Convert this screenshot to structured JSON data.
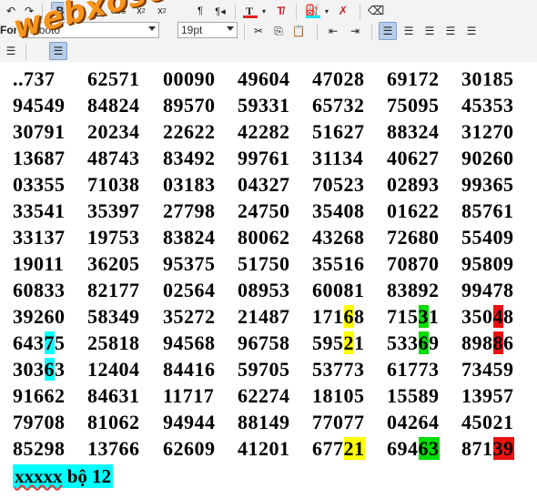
{
  "toolbar": {
    "font_name": "roboto",
    "font_size": "19pt",
    "font_label": "Font",
    "buttons_row1": [
      "undo-icon",
      "redo-icon",
      "bold-icon",
      "italic-icon",
      "underline-icon",
      "strikethrough-icon",
      "subscript-icon",
      "superscript-icon",
      "ltr-icon",
      "rtl-icon",
      "text-color-icon",
      "clear-text-color-icon",
      "highlight-color-icon",
      "clear-highlight-icon",
      "eraser-icon"
    ],
    "buttons_row2": [
      "cut-icon",
      "copy-icon",
      "paste-icon",
      "outdent-icon",
      "indent-icon",
      "align-left-icon",
      "align-center-icon",
      "align-right-icon",
      "justify-icon",
      "block-justify-icon"
    ],
    "text_color": "#e02020",
    "highlight_color": "#00e5ff"
  },
  "watermark": "webxoso.net",
  "grid": [
    [
      "..737",
      "62571",
      "00090",
      "49604",
      "47028",
      "69172",
      "30185"
    ],
    [
      "94549",
      "84824",
      "89570",
      "59331",
      "65732",
      "75095",
      "45353"
    ],
    [
      "30791",
      "20234",
      "22622",
      "42282",
      "51627",
      "88324",
      "31270"
    ],
    [
      "13687",
      "48743",
      "83492",
      "99761",
      "31134",
      "40627",
      "90260"
    ],
    [
      "03355",
      "71038",
      "03183",
      "04327",
      "70523",
      "02893",
      "99365"
    ],
    [
      "33541",
      "35397",
      "27798",
      "24750",
      "35408",
      "01622",
      "85761"
    ],
    [
      "33137",
      "19753",
      "83824",
      "80062",
      "43268",
      "72680",
      "55409"
    ],
    [
      "19011",
      "36205",
      "95375",
      "51750",
      "35516",
      "70870",
      "95809"
    ],
    [
      "60833",
      "82177",
      "02564",
      "08953",
      "60081",
      "83892",
      "99478"
    ],
    [
      "39260",
      "58349",
      "35272",
      "21487",
      "17168",
      "71531",
      "35048"
    ],
    [
      "64375",
      "25818",
      "94568",
      "96758",
      "59521",
      "53369",
      "89886"
    ],
    [
      "30363",
      "12404",
      "84416",
      "59705",
      "53773",
      "61773",
      "73459"
    ],
    [
      "91662",
      "84631",
      "11717",
      "62274",
      "18105",
      "15589",
      "13957"
    ],
    [
      "79708",
      "81062",
      "94944",
      "88149",
      "77077",
      "04264",
      "45021"
    ],
    [
      "85298",
      "13766",
      "62609",
      "41201",
      "67721",
      "69463",
      "87139"
    ]
  ],
  "highlights": {
    "yellow": "#ffff00",
    "green": "#00dd00",
    "red": "#ee1111",
    "cyan": "#00ffff"
  },
  "footer": {
    "prefix": "xxxxx",
    "text": " bộ 12"
  }
}
